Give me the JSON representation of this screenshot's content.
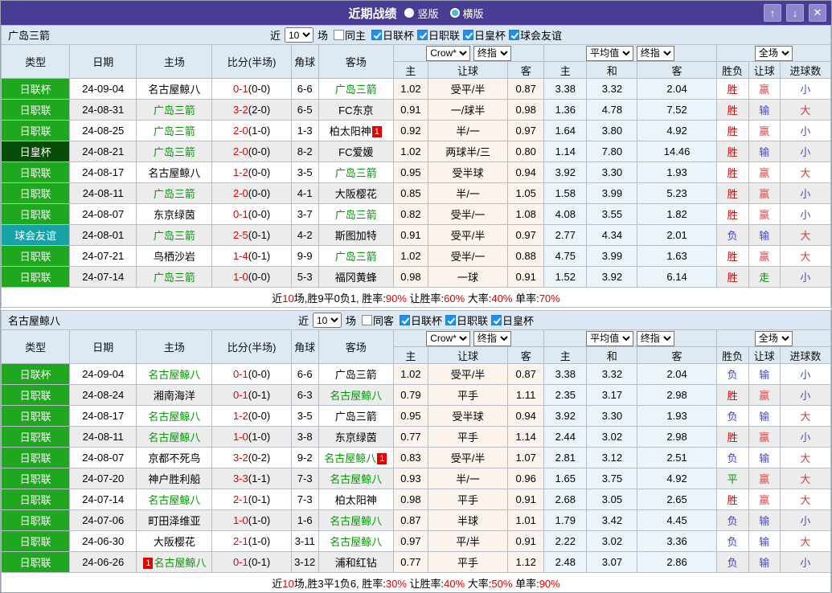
{
  "titlebar": {
    "title": "近期战绩",
    "vertical_label": "竖版",
    "horizontal_label": "横版",
    "buttons": {
      "up": "↑",
      "down": "↓",
      "close": "✕"
    }
  },
  "filter": {
    "near_label": "近",
    "games_value": "10",
    "games_label": "场"
  },
  "table": {
    "columns": [
      "类型",
      "日期",
      "主场",
      "比分(半场)",
      "角球",
      "客场"
    ],
    "sub_columns": [
      "主",
      "让球",
      "客",
      "主",
      "和",
      "客",
      "胜负",
      "让球",
      "进球数"
    ],
    "dropdowns": {
      "bookmaker": "Crow*",
      "final_odds": "终指",
      "average": "平均值",
      "final_odds2": "终指",
      "full_match": "全场"
    }
  },
  "colors": {
    "titlebar_purple": "#493c94",
    "checkbox_blue": "#2090f0",
    "team_green": "#009900",
    "score_red": "#e60000",
    "type_bg": {
      "日联杯": "#1fa71f",
      "日职联": "#1fa71f",
      "日皇杯": "#074d07",
      "球会友谊": "#17a2a8"
    },
    "outcome": {
      "胜": "#d10000",
      "负": "#4040cc",
      "平": "#009900",
      "赢": "#e04848",
      "输": "#4848cc",
      "走": "#009900",
      "大": "#d13b3b",
      "小": "#4848cc"
    }
  },
  "sections": [
    {
      "team": "广岛三箭",
      "same_venue_label": "同主",
      "competitions": [
        "日联杯",
        "日职联",
        "日皇杯",
        "球会友谊"
      ],
      "rows": [
        {
          "type": "日联杯",
          "date": "24-09-04",
          "home": "名古屋鲸八",
          "home_hl": false,
          "score": "0-1",
          "half": "(0-0)",
          "corner": "6-6",
          "away": "广岛三箭",
          "away_hl": true,
          "crow": [
            "1.02",
            "受平/半",
            "0.87"
          ],
          "avg": [
            "3.38",
            "3.32",
            "2.04"
          ],
          "res": [
            "胜",
            "赢",
            "小"
          ]
        },
        {
          "type": "日职联",
          "date": "24-08-31",
          "home": "广岛三箭",
          "home_hl": true,
          "score": "3-2",
          "half": "(2-0)",
          "corner": "6-5",
          "away": "FC东京",
          "away_hl": false,
          "crow": [
            "0.91",
            "一/球半",
            "0.98"
          ],
          "avg": [
            "1.36",
            "4.78",
            "7.52"
          ],
          "res": [
            "胜",
            "输",
            "大"
          ]
        },
        {
          "type": "日职联",
          "date": "24-08-25",
          "home": "广岛三箭",
          "home_hl": true,
          "score": "2-0",
          "half": "(1-0)",
          "corner": "1-3",
          "away": "柏太阳神",
          "away_hl": false,
          "away_badge": "1",
          "crow": [
            "0.92",
            "半/一",
            "0.97"
          ],
          "avg": [
            "1.64",
            "3.80",
            "4.92"
          ],
          "res": [
            "胜",
            "赢",
            "小"
          ]
        },
        {
          "type": "日皇杯",
          "date": "24-08-21",
          "home": "广岛三箭",
          "home_hl": true,
          "score": "2-0",
          "half": "(0-0)",
          "corner": "8-2",
          "away": "FC爱媛",
          "away_hl": false,
          "crow": [
            "1.02",
            "两球半/三",
            "0.80"
          ],
          "avg": [
            "1.14",
            "7.80",
            "14.46"
          ],
          "res": [
            "胜",
            "输",
            "小"
          ]
        },
        {
          "type": "日职联",
          "date": "24-08-17",
          "home": "名古屋鲸八",
          "home_hl": false,
          "score": "1-2",
          "half": "(0-0)",
          "corner": "3-5",
          "away": "广岛三箭",
          "away_hl": true,
          "crow": [
            "0.95",
            "受半球",
            "0.94"
          ],
          "avg": [
            "3.92",
            "3.30",
            "1.93"
          ],
          "res": [
            "胜",
            "赢",
            "大"
          ]
        },
        {
          "type": "日职联",
          "date": "24-08-11",
          "home": "广岛三箭",
          "home_hl": true,
          "score": "2-0",
          "half": "(0-0)",
          "corner": "4-1",
          "away": "大阪樱花",
          "away_hl": false,
          "crow": [
            "0.85",
            "半/一",
            "1.05"
          ],
          "avg": [
            "1.58",
            "3.99",
            "5.23"
          ],
          "res": [
            "胜",
            "赢",
            "小"
          ]
        },
        {
          "type": "日职联",
          "date": "24-08-07",
          "home": "东京绿茵",
          "home_hl": false,
          "score": "0-1",
          "half": "(0-0)",
          "corner": "3-7",
          "away": "广岛三箭",
          "away_hl": true,
          "crow": [
            "0.82",
            "受半/一",
            "1.08"
          ],
          "avg": [
            "4.08",
            "3.55",
            "1.82"
          ],
          "res": [
            "胜",
            "赢",
            "小"
          ]
        },
        {
          "type": "球会友谊",
          "date": "24-08-01",
          "home": "广岛三箭",
          "home_hl": true,
          "score": "2-5",
          "half": "(0-1)",
          "corner": "4-2",
          "away": "斯图加特",
          "away_hl": false,
          "crow": [
            "0.91",
            "受平/半",
            "0.97"
          ],
          "avg": [
            "2.77",
            "4.34",
            "2.01"
          ],
          "res": [
            "负",
            "输",
            "大"
          ]
        },
        {
          "type": "日职联",
          "date": "24-07-21",
          "home": "鸟栖沙岩",
          "home_hl": false,
          "score": "1-4",
          "half": "(0-1)",
          "corner": "9-9",
          "away": "广岛三箭",
          "away_hl": true,
          "crow": [
            "1.02",
            "受半/一",
            "0.88"
          ],
          "avg": [
            "4.75",
            "3.99",
            "1.63"
          ],
          "res": [
            "胜",
            "赢",
            "大"
          ]
        },
        {
          "type": "日职联",
          "date": "24-07-14",
          "home": "广岛三箭",
          "home_hl": true,
          "score": "1-0",
          "half": "(0-0)",
          "corner": "5-3",
          "away": "福冈黄蜂",
          "away_hl": false,
          "crow": [
            "0.98",
            "一球",
            "0.91"
          ],
          "avg": [
            "1.52",
            "3.92",
            "6.14"
          ],
          "res": [
            "胜",
            "走",
            "小"
          ]
        }
      ],
      "summary": [
        [
          "近",
          "k"
        ],
        [
          "10",
          "r"
        ],
        [
          "场,胜9平0负1, 胜率:",
          "k"
        ],
        [
          "90%",
          "r"
        ],
        [
          " 让胜率:",
          "k"
        ],
        [
          "60%",
          "r"
        ],
        [
          " 大率:",
          "k"
        ],
        [
          "40%",
          "r"
        ],
        [
          " 单率:",
          "k"
        ],
        [
          "70%",
          "r"
        ]
      ]
    },
    {
      "team": "名古屋鲸八",
      "same_venue_label": "同客",
      "competitions": [
        "日联杯",
        "日职联",
        "日皇杯"
      ],
      "rows": [
        {
          "type": "日联杯",
          "date": "24-09-04",
          "home": "名古屋鲸八",
          "home_hl": true,
          "score": "0-1",
          "half": "(0-0)",
          "corner": "6-6",
          "away": "广岛三箭",
          "away_hl": false,
          "crow": [
            "1.02",
            "受平/半",
            "0.87"
          ],
          "avg": [
            "3.38",
            "3.32",
            "2.04"
          ],
          "res": [
            "负",
            "输",
            "小"
          ]
        },
        {
          "type": "日职联",
          "date": "24-08-24",
          "home": "湘南海洋",
          "home_hl": false,
          "score": "0-1",
          "half": "(0-1)",
          "corner": "6-3",
          "away": "名古屋鲸八",
          "away_hl": true,
          "crow": [
            "0.79",
            "平手",
            "1.11"
          ],
          "avg": [
            "2.35",
            "3.17",
            "2.98"
          ],
          "res": [
            "胜",
            "赢",
            "小"
          ]
        },
        {
          "type": "日职联",
          "date": "24-08-17",
          "home": "名古屋鲸八",
          "home_hl": true,
          "score": "1-2",
          "half": "(0-0)",
          "corner": "3-5",
          "away": "广岛三箭",
          "away_hl": false,
          "crow": [
            "0.95",
            "受半球",
            "0.94"
          ],
          "avg": [
            "3.92",
            "3.30",
            "1.93"
          ],
          "res": [
            "负",
            "输",
            "大"
          ]
        },
        {
          "type": "日职联",
          "date": "24-08-11",
          "home": "名古屋鲸八",
          "home_hl": true,
          "score": "1-0",
          "half": "(1-0)",
          "corner": "3-8",
          "away": "东京绿茵",
          "away_hl": false,
          "crow": [
            "0.77",
            "平手",
            "1.14"
          ],
          "avg": [
            "2.44",
            "3.02",
            "2.98"
          ],
          "res": [
            "胜",
            "赢",
            "小"
          ]
        },
        {
          "type": "日职联",
          "date": "24-08-07",
          "home": "京都不死鸟",
          "home_hl": false,
          "score": "3-2",
          "half": "(0-2)",
          "corner": "9-2",
          "away": "名古屋鲸八",
          "away_hl": true,
          "away_badge": "1",
          "crow": [
            "0.83",
            "受平/半",
            "1.07"
          ],
          "avg": [
            "2.81",
            "3.12",
            "2.51"
          ],
          "res": [
            "负",
            "输",
            "大"
          ]
        },
        {
          "type": "日职联",
          "date": "24-07-20",
          "home": "神户胜利船",
          "home_hl": false,
          "score": "3-3",
          "half": "(1-1)",
          "corner": "7-3",
          "away": "名古屋鲸八",
          "away_hl": true,
          "crow": [
            "0.93",
            "半/一",
            "0.96"
          ],
          "avg": [
            "1.65",
            "3.75",
            "4.92"
          ],
          "res": [
            "平",
            "赢",
            "大"
          ]
        },
        {
          "type": "日职联",
          "date": "24-07-14",
          "home": "名古屋鲸八",
          "home_hl": true,
          "score": "2-1",
          "half": "(0-1)",
          "corner": "7-3",
          "away": "柏太阳神",
          "away_hl": false,
          "crow": [
            "0.98",
            "平手",
            "0.91"
          ],
          "avg": [
            "2.68",
            "3.05",
            "2.65"
          ],
          "res": [
            "胜",
            "赢",
            "大"
          ]
        },
        {
          "type": "日职联",
          "date": "24-07-06",
          "home": "町田泽维亚",
          "home_hl": false,
          "score": "1-0",
          "half": "(1-0)",
          "corner": "1-6",
          "away": "名古屋鲸八",
          "away_hl": true,
          "crow": [
            "0.87",
            "半球",
            "1.01"
          ],
          "avg": [
            "1.79",
            "3.42",
            "4.45"
          ],
          "res": [
            "负",
            "输",
            "小"
          ]
        },
        {
          "type": "日职联",
          "date": "24-06-30",
          "home": "大阪樱花",
          "home_hl": false,
          "score": "2-1",
          "half": "(1-0)",
          "corner": "3-11",
          "away": "名古屋鲸八",
          "away_hl": true,
          "crow": [
            "0.97",
            "平/半",
            "0.91"
          ],
          "avg": [
            "2.22",
            "3.02",
            "3.36"
          ],
          "res": [
            "负",
            "输",
            "大"
          ]
        },
        {
          "type": "日职联",
          "date": "24-06-26",
          "home": "名古屋鲸八",
          "home_hl": true,
          "home_badge": "1",
          "home_badge_pos": "pre",
          "score": "0-1",
          "half": "(0-1)",
          "corner": "3-12",
          "away": "浦和红钻",
          "away_hl": false,
          "crow": [
            "0.77",
            "平手",
            "1.12"
          ],
          "avg": [
            "2.48",
            "3.07",
            "2.86"
          ],
          "res": [
            "负",
            "输",
            "小"
          ]
        }
      ],
      "summary": [
        [
          "近",
          "k"
        ],
        [
          "10",
          "r"
        ],
        [
          "场,胜3平1负6, 胜率:",
          "k"
        ],
        [
          "30%",
          "r"
        ],
        [
          " 让胜率:",
          "k"
        ],
        [
          "40%",
          "r"
        ],
        [
          " 大率:",
          "k"
        ],
        [
          "50%",
          "r"
        ],
        [
          " 单率:",
          "k"
        ],
        [
          "90%",
          "r"
        ]
      ]
    }
  ]
}
